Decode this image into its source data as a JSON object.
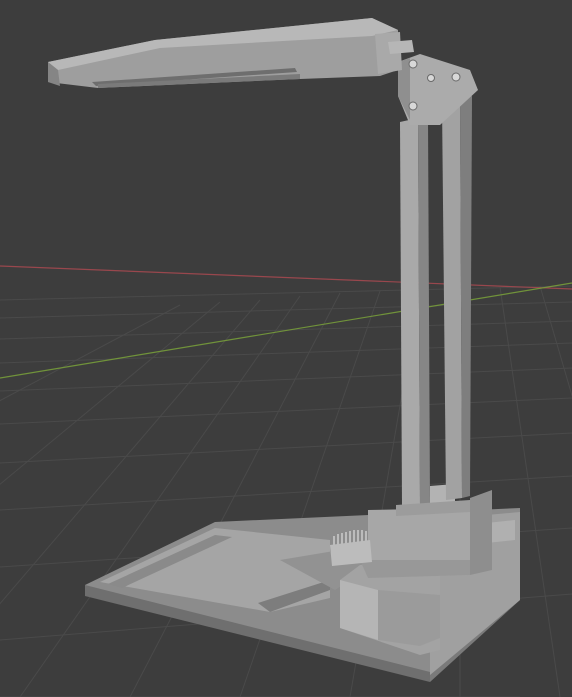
{
  "viewport": {
    "background": "#3d3d3d",
    "grid_color": "#4a4a4a",
    "x_axis_color": "#b04a52",
    "y_axis_color": "#7aa23a"
  },
  "model": {
    "object": "desk-lamp",
    "material_color": "#9a9a9a"
  }
}
